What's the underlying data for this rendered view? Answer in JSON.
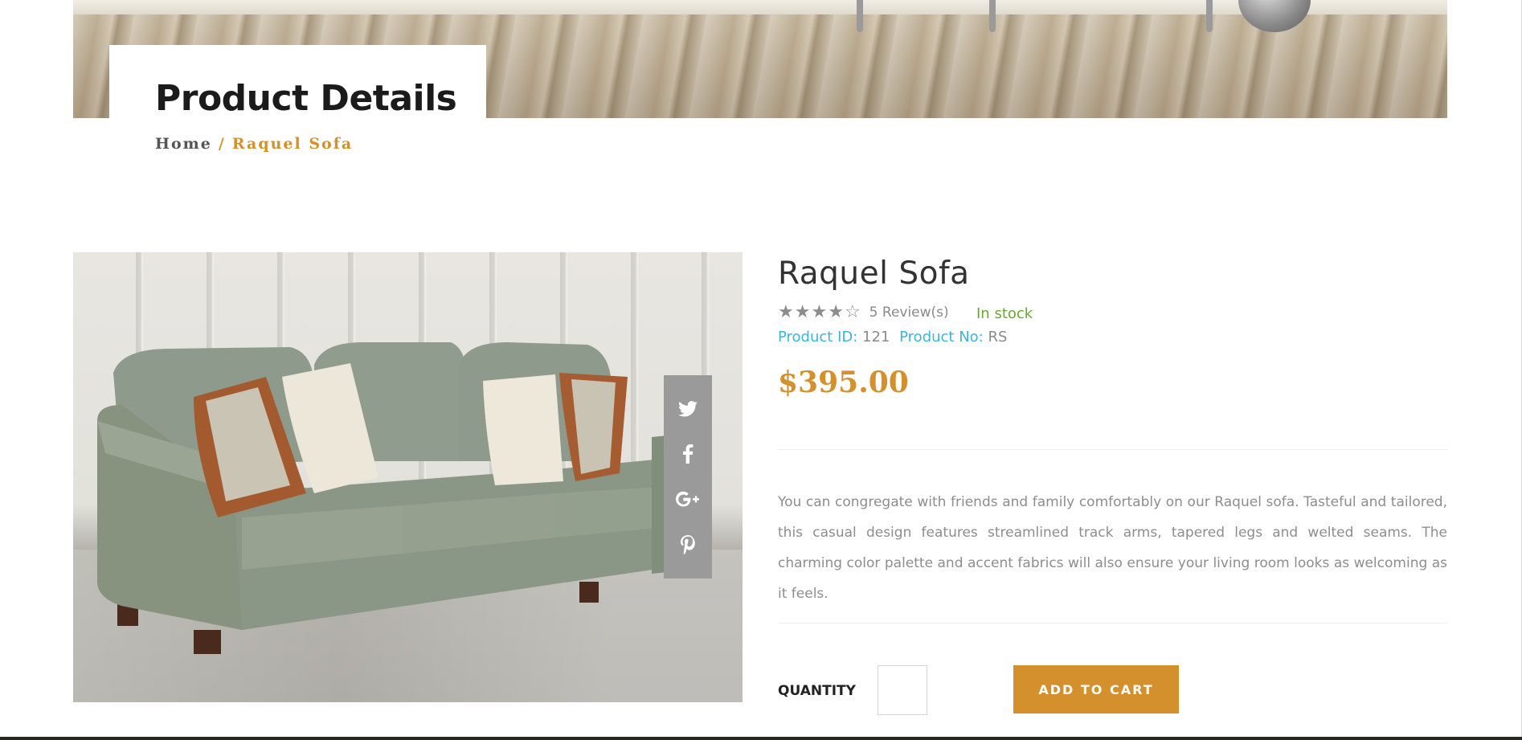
{
  "page": {
    "title": "Product Details",
    "breadcrumb": {
      "home": "Home",
      "separator": "/",
      "current": "Raquel Sofa"
    }
  },
  "product": {
    "name": "Raquel Sofa",
    "rating": 4,
    "rating_max": 5,
    "reviews_text": "5 Review(s)",
    "stock_status": "In stock",
    "id_label": "Product ID:",
    "id_value": "121",
    "no_label": "Product No:",
    "no_value": "RS",
    "price": "$395.00",
    "description": "You can congregate with friends and family comfortably on our Raquel sofa. Tasteful and tailored, this casual design features streamlined track arms, tapered legs and welted seams. The charming color palette and accent fabrics will also ensure your living room looks as welcoming as it feels.",
    "image_icon": "sofa-image"
  },
  "share": {
    "icons": [
      "twitter-icon",
      "facebook-icon",
      "google-plus-icon",
      "pinterest-icon"
    ]
  },
  "cart": {
    "quantity_label": "QUANTITY",
    "quantity_value": "",
    "add_to_cart_label": "ADD TO CART"
  },
  "colors": {
    "accent": "#d5902e",
    "link": "#38b7d8",
    "in_stock": "#6aa82b",
    "share_bar": "#9a9a9a"
  }
}
